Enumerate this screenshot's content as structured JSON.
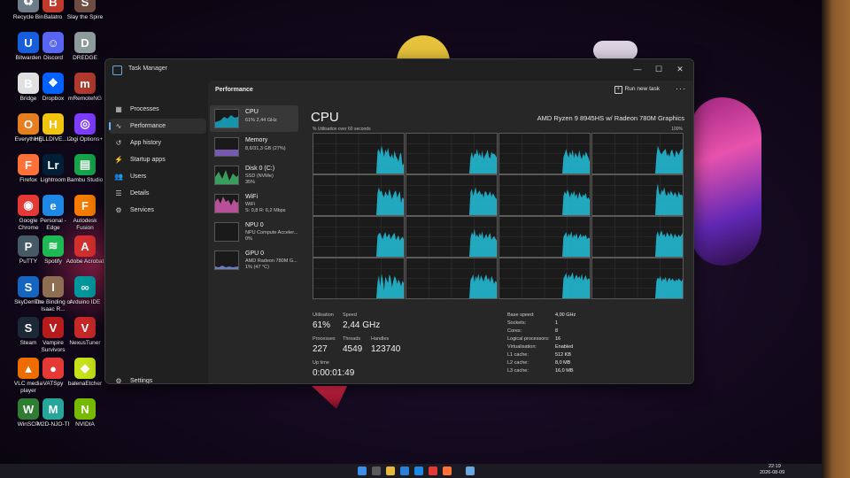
{
  "desktop": {
    "icons": [
      {
        "label": "Recycle Bin",
        "glyph": "♻",
        "color": "#6e7c8a"
      },
      {
        "label": "Balatro",
        "glyph": "B",
        "color": "#c0392b"
      },
      {
        "label": "Slay the Spire",
        "glyph": "S",
        "color": "#6d4c41"
      },
      {
        "label": "Bitwarden",
        "glyph": "U",
        "color": "#175ddc"
      },
      {
        "label": "Discord",
        "glyph": "☺",
        "color": "#5865f2"
      },
      {
        "label": "DREDGE",
        "glyph": "D",
        "color": "#8d9c9a"
      },
      {
        "label": "Bridge",
        "glyph": "B",
        "color": "#e0e0e0"
      },
      {
        "label": "Dropbox",
        "glyph": "❖",
        "color": "#0061fe"
      },
      {
        "label": "mRemoteNG",
        "glyph": "m",
        "color": "#b03a2e"
      },
      {
        "label": "Everything",
        "glyph": "O",
        "color": "#e67e22"
      },
      {
        "label": "HELLDIVE... 2",
        "glyph": "H",
        "color": "#f1c40f"
      },
      {
        "label": "Logi Options+",
        "glyph": "◎",
        "color": "#7d3cff"
      },
      {
        "label": "Firefox",
        "glyph": "F",
        "color": "#ff7139"
      },
      {
        "label": "Lightroom",
        "glyph": "Lr",
        "color": "#001e36"
      },
      {
        "label": "Bambu Studio",
        "glyph": "▤",
        "color": "#16a34a"
      },
      {
        "label": "Google Chrome",
        "glyph": "◉",
        "color": "#e53935"
      },
      {
        "label": "Personal - Edge",
        "glyph": "e",
        "color": "#1e88e5"
      },
      {
        "label": "Autodesk Fusion",
        "glyph": "F",
        "color": "#f57c00"
      },
      {
        "label": "PuTTY",
        "glyph": "P",
        "color": "#455a64"
      },
      {
        "label": "Spotify",
        "glyph": "≋",
        "color": "#1db954"
      },
      {
        "label": "Adobe Acrobat",
        "glyph": "A",
        "color": "#d32f2f"
      },
      {
        "label": "SkyDemon",
        "glyph": "S",
        "color": "#1565c0"
      },
      {
        "label": "The Binding of Isaac R...",
        "glyph": "I",
        "color": "#8e6e53"
      },
      {
        "label": "Arduino IDE",
        "glyph": "∞",
        "color": "#00979d"
      },
      {
        "label": "Steam",
        "glyph": "S",
        "color": "#1b2838"
      },
      {
        "label": "Vampire Survivors",
        "glyph": "V",
        "color": "#b71c1c"
      },
      {
        "label": "NexusTuner",
        "glyph": "V",
        "color": "#c62828"
      },
      {
        "label": "VLC media player",
        "glyph": "▲",
        "color": "#ef6c00"
      },
      {
        "label": "VATSpy",
        "glyph": "●",
        "color": "#e53935"
      },
      {
        "label": "balenaEtcher",
        "glyph": "◆",
        "color": "#c6e31a"
      },
      {
        "label": "WinSCP",
        "glyph": "W",
        "color": "#2e7d32"
      },
      {
        "label": "M2D-NJO-TI",
        "glyph": "M",
        "color": "#26a69a"
      },
      {
        "label": "NVIDIA",
        "glyph": "N",
        "color": "#76b900"
      }
    ]
  },
  "window": {
    "title": "Task Manager",
    "minimize": "—",
    "maximize": "☐",
    "close": "✕"
  },
  "sidebar": {
    "items": [
      {
        "label": "Processes",
        "icon": "▦"
      },
      {
        "label": "Performance",
        "icon": "∿"
      },
      {
        "label": "App history",
        "icon": "↺"
      },
      {
        "label": "Startup apps",
        "icon": "⚡"
      },
      {
        "label": "Users",
        "icon": "👥"
      },
      {
        "label": "Details",
        "icon": "☰"
      },
      {
        "label": "Services",
        "icon": "⚙"
      }
    ],
    "settings": {
      "label": "Settings",
      "icon": "⚙"
    }
  },
  "header": {
    "title": "Performance",
    "run_new_task": "Run new task",
    "more": "···"
  },
  "resources": [
    {
      "name": "CPU",
      "sub1": "61% 2,44 GHz",
      "sub2": "",
      "color": "#17a9c6"
    },
    {
      "name": "Memory",
      "sub1": "8,6/31,3 GB (27%)",
      "sub2": "",
      "color": "#8f6bd9"
    },
    {
      "name": "Disk 0 (C:)",
      "sub1": "SSD (NVMe)",
      "sub2": "35%",
      "color": "#3fb56a"
    },
    {
      "name": "WiFi",
      "sub1": "WiFi",
      "sub2": "S: 0,8 R: 6,2 Mbps",
      "color": "#d45ab0"
    },
    {
      "name": "NPU 0",
      "sub1": "NPU Compute Acceler...",
      "sub2": "0%",
      "color": "#8a8a8a"
    },
    {
      "name": "GPU 0",
      "sub1": "AMD Radeon 780M G...",
      "sub2": "1% (47 °C)",
      "color": "#7d8fd6"
    }
  ],
  "cpu": {
    "title": "CPU",
    "model": "AMD Ryzen 9 8945HS w/ Radeon 780M Graphics",
    "graph_caption": "% Utilisation over 60 seconds",
    "graph_max": "100%",
    "graph_color": "#22b8d1",
    "cores": [
      [
        0,
        0,
        0,
        0,
        0,
        0,
        0,
        0,
        0,
        0,
        0,
        0,
        0,
        0,
        0,
        0,
        0,
        0,
        0,
        0,
        0,
        0,
        0,
        0,
        0,
        0,
        0,
        0,
        0,
        0,
        0,
        0,
        0,
        0,
        0,
        0,
        0,
        0,
        0,
        0,
        0,
        0,
        0,
        0,
        0,
        0,
        0,
        0,
        0,
        55,
        62,
        48,
        70,
        58,
        42,
        60,
        52,
        65,
        45,
        40,
        50,
        36,
        58,
        44,
        38,
        30,
        48,
        52,
        20,
        25
      ],
      [
        0,
        0,
        0,
        0,
        0,
        0,
        0,
        0,
        0,
        0,
        0,
        0,
        0,
        0,
        0,
        0,
        0,
        0,
        0,
        0,
        0,
        0,
        0,
        0,
        0,
        0,
        0,
        0,
        0,
        0,
        0,
        0,
        0,
        0,
        0,
        0,
        0,
        0,
        0,
        0,
        0,
        0,
        0,
        0,
        0,
        0,
        0,
        0,
        0,
        40,
        55,
        38,
        50,
        48,
        62,
        44,
        52,
        40,
        58,
        36,
        45,
        50,
        60,
        42,
        38,
        55,
        48,
        50,
        46,
        40
      ],
      [
        0,
        0,
        0,
        0,
        0,
        0,
        0,
        0,
        0,
        0,
        0,
        0,
        0,
        0,
        0,
        0,
        0,
        0,
        0,
        0,
        0,
        0,
        0,
        0,
        0,
        0,
        0,
        0,
        0,
        0,
        0,
        0,
        0,
        0,
        0,
        0,
        0,
        0,
        0,
        0,
        0,
        0,
        0,
        0,
        0,
        0,
        0,
        0,
        0,
        42,
        50,
        62,
        48,
        40,
        55,
        45,
        60,
        38,
        52,
        46,
        40,
        58,
        44,
        36,
        50,
        42,
        55,
        48,
        40,
        30
      ],
      [
        0,
        0,
        0,
        0,
        0,
        0,
        0,
        0,
        0,
        0,
        0,
        0,
        0,
        0,
        0,
        0,
        0,
        0,
        0,
        0,
        0,
        0,
        0,
        0,
        0,
        0,
        0,
        0,
        0,
        0,
        0,
        0,
        0,
        0,
        0,
        0,
        0,
        0,
        0,
        0,
        0,
        0,
        0,
        0,
        0,
        0,
        0,
        0,
        0,
        45,
        70,
        60,
        52,
        48,
        55,
        58,
        62,
        44,
        50,
        42,
        56,
        60,
        48,
        40,
        58,
        52,
        46,
        55,
        60,
        62
      ],
      [
        0,
        0,
        0,
        0,
        0,
        0,
        0,
        0,
        0,
        0,
        0,
        0,
        0,
        0,
        0,
        0,
        0,
        0,
        0,
        0,
        0,
        0,
        0,
        0,
        0,
        0,
        0,
        0,
        0,
        0,
        0,
        0,
        0,
        0,
        0,
        0,
        0,
        0,
        0,
        0,
        0,
        0,
        0,
        0,
        0,
        0,
        0,
        0,
        0,
        55,
        70,
        58,
        62,
        50,
        45,
        60,
        52,
        48,
        66,
        54,
        40,
        50,
        58,
        62,
        44,
        52,
        60,
        30,
        45,
        40
      ],
      [
        0,
        0,
        0,
        0,
        0,
        0,
        0,
        0,
        0,
        0,
        0,
        0,
        0,
        0,
        0,
        0,
        0,
        0,
        0,
        0,
        0,
        0,
        0,
        0,
        0,
        0,
        0,
        0,
        0,
        0,
        0,
        0,
        0,
        0,
        0,
        0,
        0,
        0,
        0,
        0,
        0,
        0,
        0,
        0,
        0,
        0,
        0,
        0,
        0,
        58,
        66,
        48,
        60,
        70,
        52,
        58,
        62,
        50,
        55,
        44,
        60,
        58,
        48,
        52,
        60,
        46,
        55,
        50,
        44,
        40
      ],
      [
        0,
        0,
        0,
        0,
        0,
        0,
        0,
        0,
        0,
        0,
        0,
        0,
        0,
        0,
        0,
        0,
        0,
        0,
        0,
        0,
        0,
        0,
        0,
        0,
        0,
        0,
        0,
        0,
        0,
        0,
        0,
        0,
        0,
        0,
        0,
        0,
        0,
        0,
        0,
        0,
        0,
        0,
        0,
        0,
        0,
        0,
        0,
        0,
        0,
        48,
        60,
        52,
        64,
        56,
        44,
        58,
        50,
        62,
        46,
        54,
        40,
        58,
        50,
        44,
        52,
        48,
        56,
        40,
        45,
        38
      ],
      [
        0,
        0,
        0,
        0,
        0,
        0,
        0,
        0,
        0,
        0,
        0,
        0,
        0,
        0,
        0,
        0,
        0,
        0,
        0,
        0,
        0,
        0,
        0,
        0,
        0,
        0,
        0,
        0,
        0,
        0,
        0,
        0,
        0,
        0,
        0,
        0,
        0,
        0,
        0,
        0,
        0,
        0,
        0,
        0,
        0,
        0,
        0,
        0,
        0,
        60,
        80,
        55,
        50,
        64,
        58,
        70,
        52,
        48,
        60,
        50,
        62,
        55,
        48,
        58,
        52,
        44,
        60,
        50,
        52,
        48
      ],
      [
        0,
        0,
        0,
        0,
        0,
        0,
        0,
        0,
        0,
        0,
        0,
        0,
        0,
        0,
        0,
        0,
        0,
        0,
        0,
        0,
        0,
        0,
        0,
        0,
        0,
        0,
        0,
        0,
        0,
        0,
        0,
        0,
        0,
        0,
        0,
        0,
        0,
        0,
        0,
        0,
        0,
        0,
        0,
        0,
        0,
        0,
        0,
        0,
        0,
        52,
        58,
        60,
        50,
        44,
        56,
        62,
        48,
        54,
        58,
        44,
        50,
        56,
        60,
        42,
        48,
        54,
        40,
        46,
        50,
        44
      ],
      [
        0,
        0,
        0,
        0,
        0,
        0,
        0,
        0,
        0,
        0,
        0,
        0,
        0,
        0,
        0,
        0,
        0,
        0,
        0,
        0,
        0,
        0,
        0,
        0,
        0,
        0,
        0,
        0,
        0,
        0,
        0,
        0,
        0,
        0,
        0,
        0,
        0,
        0,
        0,
        0,
        0,
        0,
        0,
        0,
        0,
        0,
        0,
        0,
        0,
        46,
        62,
        54,
        70,
        50,
        56,
        48,
        60,
        52,
        64,
        44,
        50,
        58,
        46,
        54,
        60,
        42,
        48,
        52,
        46,
        40
      ],
      [
        0,
        0,
        0,
        0,
        0,
        0,
        0,
        0,
        0,
        0,
        0,
        0,
        0,
        0,
        0,
        0,
        0,
        0,
        0,
        0,
        0,
        0,
        0,
        0,
        0,
        0,
        0,
        0,
        0,
        0,
        0,
        0,
        0,
        0,
        0,
        0,
        0,
        0,
        0,
        0,
        0,
        0,
        0,
        0,
        0,
        0,
        0,
        0,
        0,
        50,
        56,
        62,
        48,
        58,
        52,
        64,
        46,
        56,
        50,
        60,
        44,
        52,
        58,
        48,
        54,
        50,
        56,
        44,
        48,
        46
      ],
      [
        0,
        0,
        0,
        0,
        0,
        0,
        0,
        0,
        0,
        0,
        0,
        0,
        0,
        0,
        0,
        0,
        0,
        0,
        0,
        0,
        0,
        0,
        0,
        0,
        0,
        0,
        0,
        0,
        0,
        0,
        0,
        0,
        0,
        0,
        0,
        0,
        0,
        0,
        0,
        0,
        0,
        0,
        0,
        0,
        0,
        0,
        0,
        0,
        0,
        54,
        64,
        50,
        60,
        66,
        52,
        58,
        48,
        62,
        56,
        50,
        60,
        54,
        46,
        58,
        52,
        48,
        56,
        50,
        54,
        60
      ],
      [
        0,
        0,
        0,
        0,
        0,
        0,
        0,
        0,
        0,
        0,
        0,
        0,
        0,
        0,
        0,
        0,
        0,
        0,
        0,
        0,
        0,
        0,
        0,
        0,
        0,
        0,
        0,
        0,
        0,
        0,
        0,
        0,
        0,
        0,
        0,
        0,
        0,
        0,
        0,
        0,
        0,
        0,
        0,
        0,
        0,
        0,
        0,
        0,
        0,
        40,
        58,
        30,
        62,
        48,
        20,
        55,
        46,
        38,
        60,
        52,
        28,
        44,
        56,
        50,
        36,
        48,
        40,
        30,
        44,
        38
      ],
      [
        0,
        0,
        0,
        0,
        0,
        0,
        0,
        0,
        0,
        0,
        0,
        0,
        0,
        0,
        0,
        0,
        0,
        0,
        0,
        0,
        0,
        0,
        0,
        0,
        0,
        0,
        0,
        0,
        0,
        0,
        0,
        0,
        0,
        0,
        0,
        0,
        0,
        0,
        0,
        0,
        0,
        0,
        0,
        0,
        0,
        0,
        0,
        0,
        0,
        46,
        52,
        60,
        40,
        56,
        48,
        62,
        44,
        58,
        50,
        42,
        54,
        60,
        46,
        52,
        40,
        56,
        48,
        36,
        44,
        40
      ],
      [
        0,
        0,
        0,
        0,
        0,
        0,
        0,
        0,
        0,
        0,
        0,
        0,
        0,
        0,
        0,
        0,
        0,
        0,
        0,
        0,
        0,
        0,
        0,
        0,
        0,
        0,
        0,
        0,
        0,
        0,
        0,
        0,
        0,
        0,
        0,
        0,
        0,
        0,
        0,
        0,
        0,
        0,
        0,
        0,
        0,
        0,
        0,
        0,
        0,
        50,
        56,
        64,
        48,
        60,
        52,
        58,
        66,
        46,
        54,
        60,
        50,
        56,
        48,
        62,
        44,
        52,
        58,
        46,
        50,
        48
      ],
      [
        0,
        0,
        0,
        0,
        0,
        0,
        0,
        0,
        0,
        0,
        0,
        0,
        0,
        0,
        0,
        0,
        0,
        0,
        0,
        0,
        0,
        0,
        0,
        0,
        0,
        0,
        0,
        0,
        0,
        0,
        0,
        0,
        0,
        0,
        0,
        0,
        0,
        0,
        0,
        0,
        0,
        0,
        0,
        0,
        0,
        0,
        0,
        0,
        0,
        44,
        52,
        48,
        56,
        42,
        50,
        46,
        54,
        40,
        48,
        52,
        44,
        50,
        46,
        42,
        48,
        44,
        50,
        46,
        42,
        48
      ]
    ],
    "stats": {
      "utilisation_label": "Utilisation",
      "utilisation": "61%",
      "speed_label": "Speed",
      "speed": "2,44 GHz",
      "processes_label": "Processes",
      "processes": "227",
      "threads_label": "Threads",
      "threads": "4549",
      "handles_label": "Handles",
      "handles": "123740",
      "uptime_label": "Up time",
      "uptime": "0:00:01:49"
    },
    "specs": [
      {
        "label": "Base speed:",
        "value": "4,00 GHz"
      },
      {
        "label": "Sockets:",
        "value": "1"
      },
      {
        "label": "Cores:",
        "value": "8"
      },
      {
        "label": "Logical processors:",
        "value": "16"
      },
      {
        "label": "Virtualisation:",
        "value": "Enabled"
      },
      {
        "label": "L1 cache:",
        "value": "512 KB"
      },
      {
        "label": "L2 cache:",
        "value": "8,0 MB"
      },
      {
        "label": "L3 cache:",
        "value": "16,0 MB"
      }
    ]
  },
  "taskbar": {
    "time": "22:19",
    "date": "2026-08-09",
    "pinned": [
      "windows",
      "search",
      "explorer",
      "edge",
      "store",
      "chrome",
      "firefox",
      "taskmgr"
    ]
  }
}
